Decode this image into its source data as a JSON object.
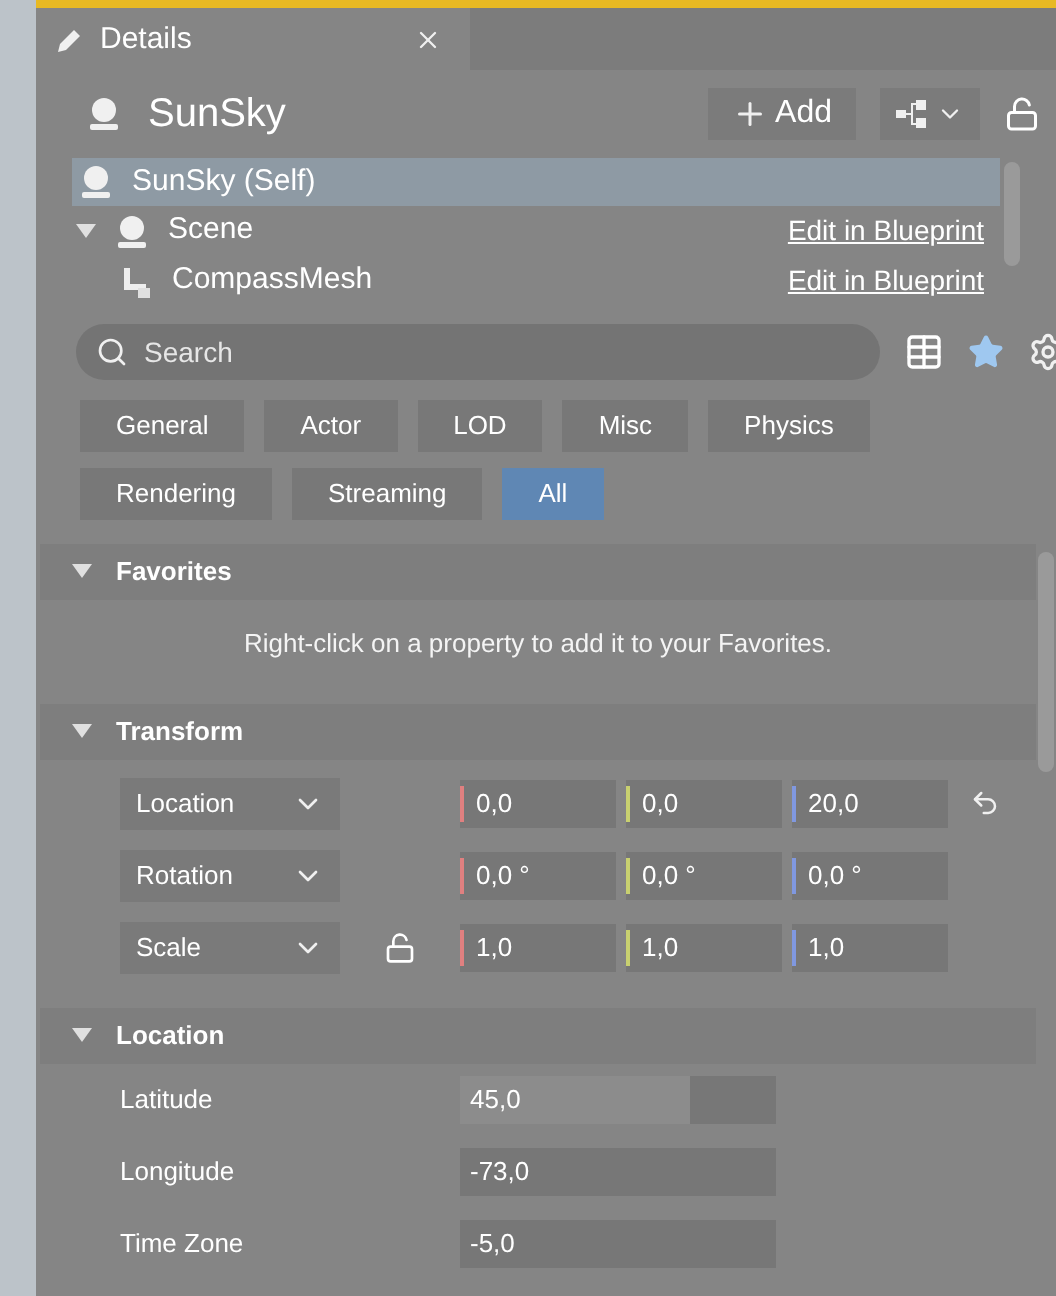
{
  "tab": {
    "title": "Details"
  },
  "actor": {
    "name": "SunSky",
    "add_button": "Add"
  },
  "components": [
    {
      "name": "SunSky (Self)",
      "selected": true
    },
    {
      "name": "Scene",
      "selected": false,
      "expanded": true,
      "link": "Edit in Blueprint",
      "children": [
        {
          "name": "CompassMesh",
          "selected": false,
          "link": "Edit in Blueprint"
        }
      ]
    }
  ],
  "search": {
    "placeholder": "Search"
  },
  "filters": [
    [
      {
        "label": "General",
        "selected": false
      },
      {
        "label": "Actor",
        "selected": false
      },
      {
        "label": "LOD",
        "selected": false
      },
      {
        "label": "Misc",
        "selected": false
      },
      {
        "label": "Physics",
        "selected": false
      }
    ],
    [
      {
        "label": "Rendering",
        "selected": false
      },
      {
        "label": "Streaming",
        "selected": false
      },
      {
        "label": "All",
        "selected": true
      }
    ]
  ],
  "sections": [
    {
      "kind": "hint",
      "title": "Favorites",
      "expanded": true,
      "hint": "Right-click on a property to add it to your Favorites."
    },
    {
      "kind": "vector",
      "title": "Transform",
      "expanded": true,
      "rows": [
        {
          "label": "Location",
          "values": [
            "0,0",
            "0,0",
            "20,0"
          ],
          "ratio_lock": false,
          "resettable": true
        },
        {
          "label": "Rotation",
          "values": [
            "0,0 °",
            "0,0 °",
            "0,0 °"
          ],
          "ratio_lock": false,
          "resettable": false
        },
        {
          "label": "Scale",
          "values": [
            "1,0",
            "1,0",
            "1,0"
          ],
          "ratio_lock": true,
          "resettable": false
        }
      ]
    },
    {
      "kind": "properties",
      "title": "Location",
      "expanded": true,
      "rows": [
        {
          "label": "Latitude",
          "value": "45,0",
          "level": 0.73
        },
        {
          "label": "Longitude",
          "value": "-73,0"
        },
        {
          "label": "Time Zone",
          "value": "-5,0"
        }
      ]
    }
  ]
}
